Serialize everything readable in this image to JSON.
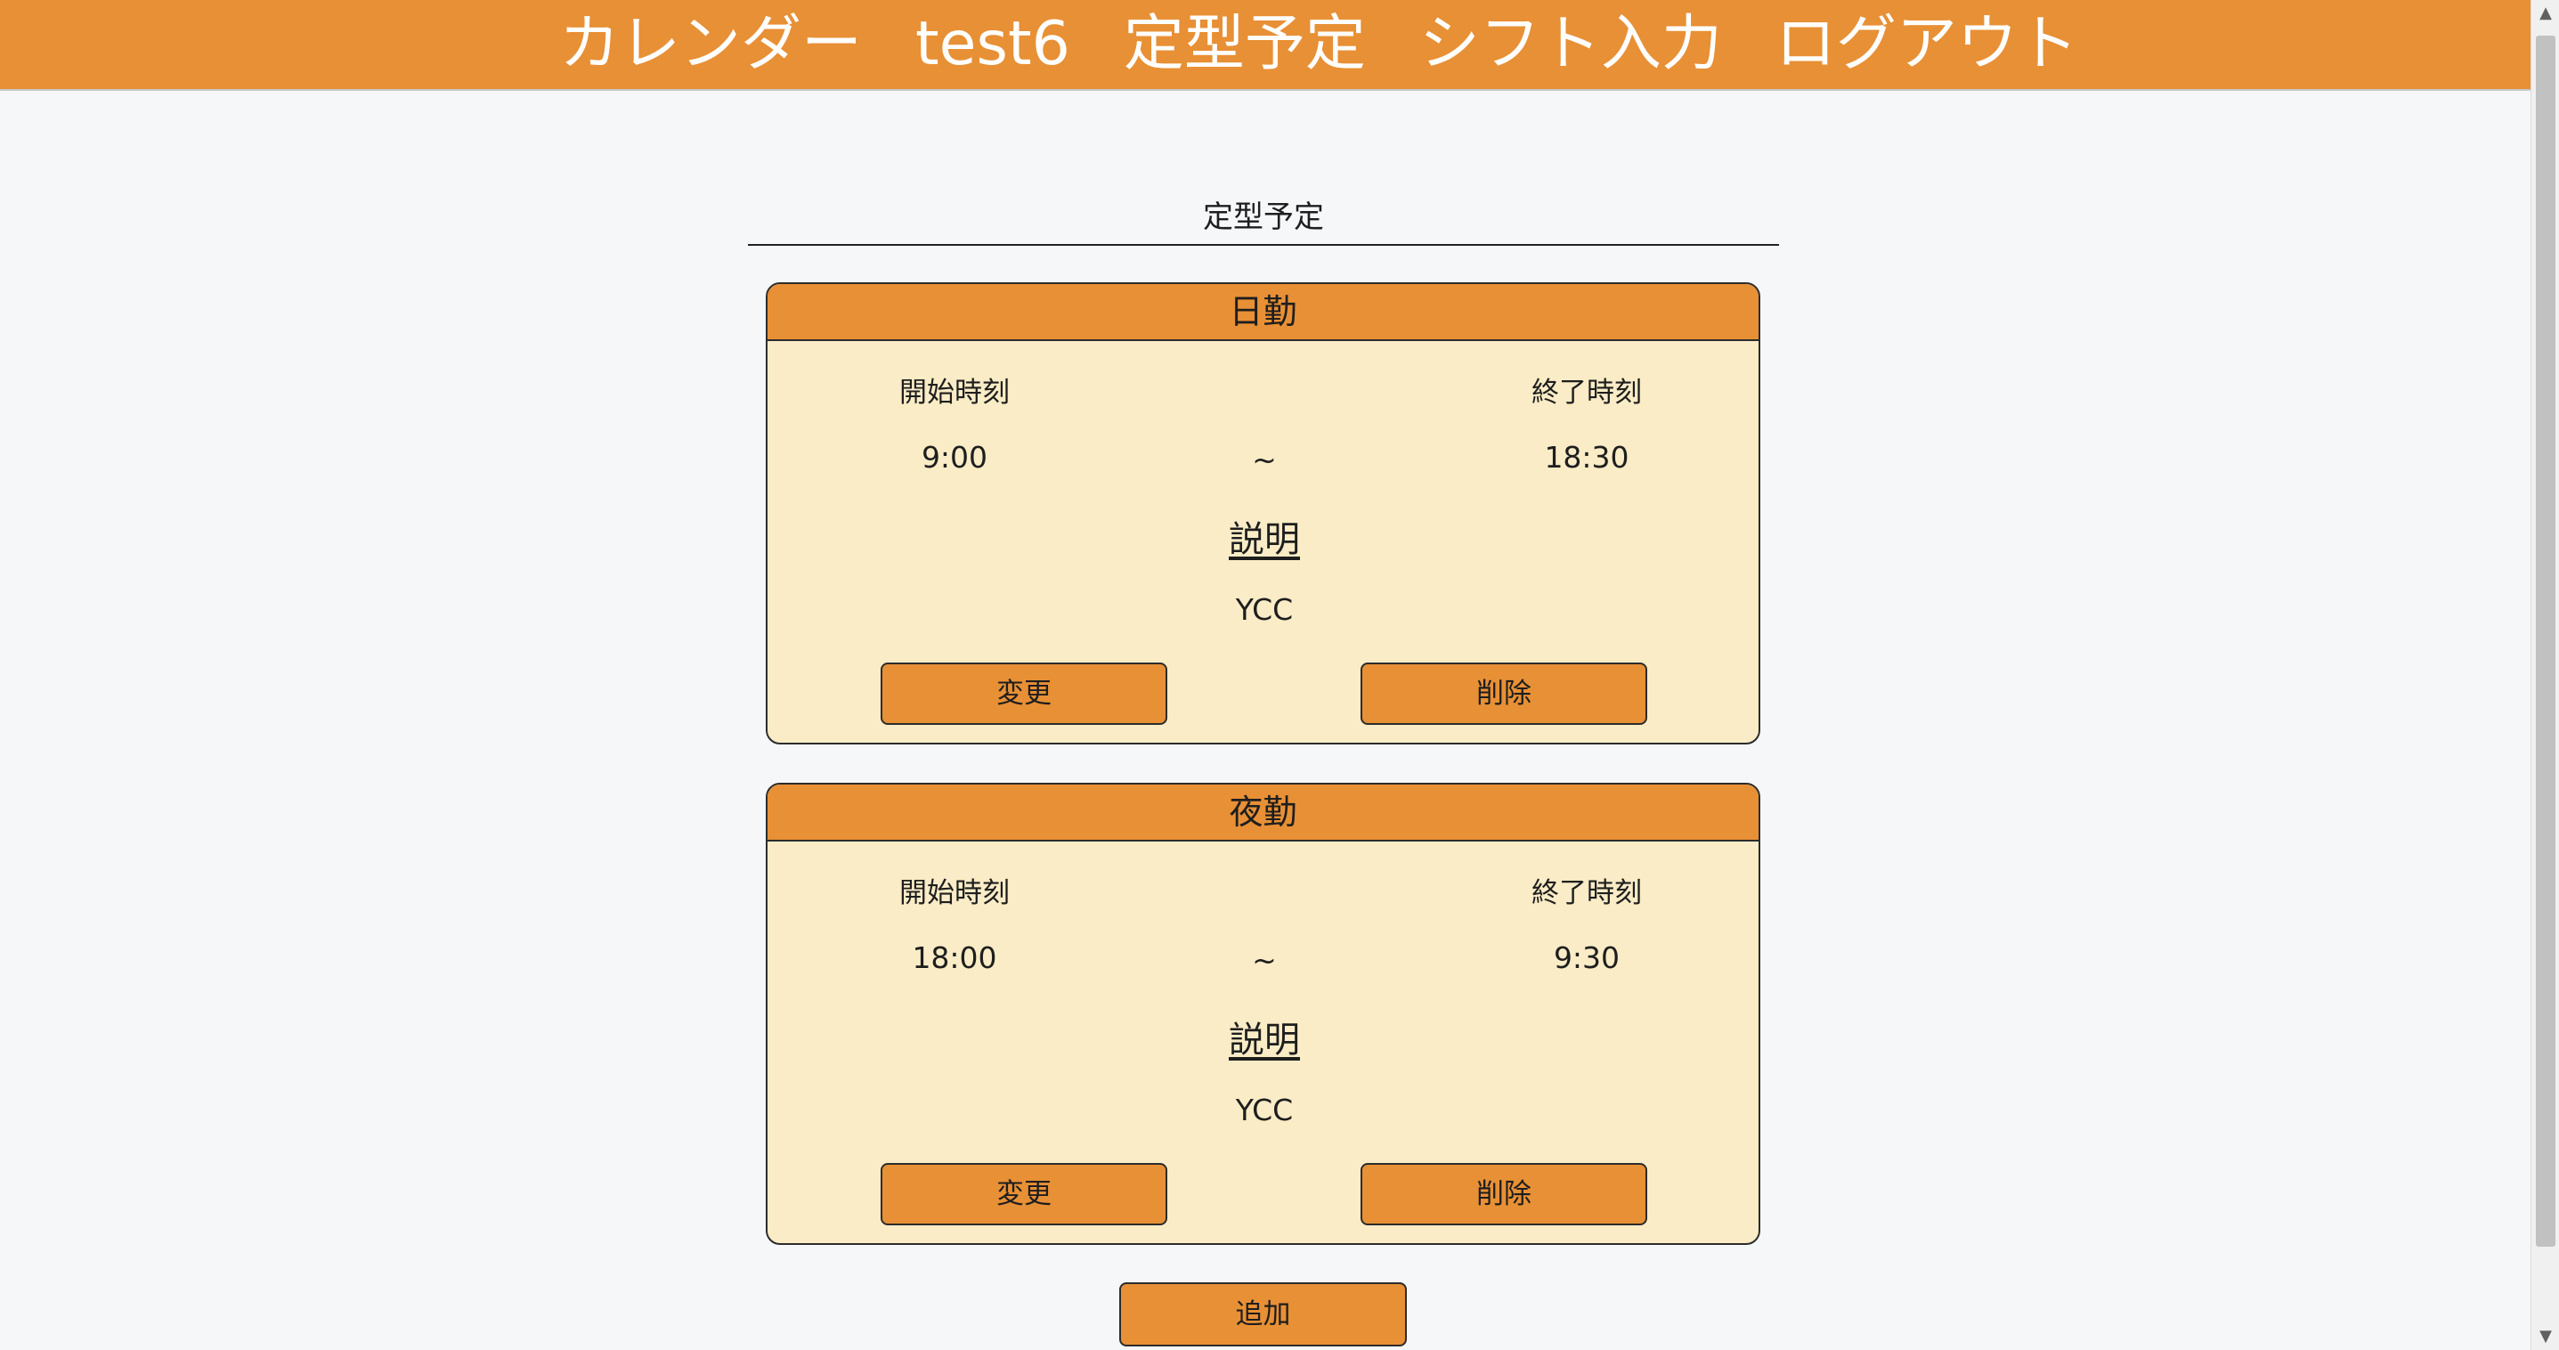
{
  "nav": {
    "items": [
      {
        "label": "カレンダー"
      },
      {
        "label": "test6"
      },
      {
        "label": "定型予定"
      },
      {
        "label": "シフト入力"
      },
      {
        "label": "ログアウト"
      }
    ]
  },
  "page": {
    "title": "定型予定"
  },
  "schedules": [
    {
      "name": "日勤",
      "start_label": "開始時刻",
      "end_label": "終了時刻",
      "start_time": "9:00",
      "separator": "~",
      "end_time": "18:30",
      "description_heading": "説明",
      "description": "YCC",
      "edit_label": "変更",
      "delete_label": "削除"
    },
    {
      "name": "夜勤",
      "start_label": "開始時刻",
      "end_label": "終了時刻",
      "start_time": "18:00",
      "separator": "~",
      "end_time": "9:30",
      "description_heading": "説明",
      "description": "YCC",
      "edit_label": "変更",
      "delete_label": "削除"
    }
  ],
  "actions": {
    "add_label": "追加"
  },
  "scrollbar": {
    "up_icon": "▲",
    "down_icon": "▼"
  },
  "colors": {
    "accent": "#e89035",
    "card_bg": "#f9ecc6",
    "page_bg": "#f6f7f9"
  }
}
